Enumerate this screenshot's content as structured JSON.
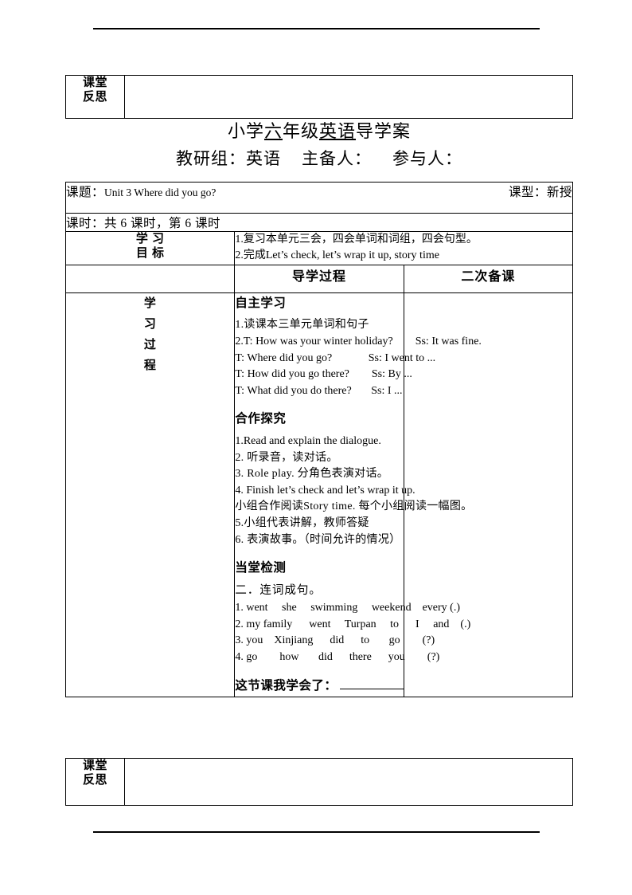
{
  "document": {
    "title_main_prefix": "小学",
    "title_underlined_1": "六",
    "title_mid": "年级",
    "title_underlined_2": "英语",
    "title_suffix": "导学案",
    "title_full": "小学六年级英语导学案",
    "subtitle_group_label": "教研组：",
    "subtitle_group_value": "英语",
    "subtitle_main_editor": "主备人：",
    "subtitle_participants": "参与人："
  },
  "reflection_top": {
    "label_line1": "课堂",
    "label_line2": "反思",
    "content": ""
  },
  "course_info": {
    "topic_label": "课题：",
    "topic_value": "Unit 3 Where did you go?",
    "type_label": "课型：",
    "type_value": "新授",
    "period_text": "课时：共 6 课时，第 6 课时",
    "period_total": "6",
    "period_current": "6"
  },
  "objectives": {
    "label_line1": "学 习",
    "label_line2": "目 标",
    "items": [
      "1.复习本单元三会，四会单词和词组，四会句型。",
      "2.完成Let’s check, let’s wrap it up, story time"
    ]
  },
  "process_header": {
    "main": "导学过程",
    "secondary": "二次备课"
  },
  "process": {
    "label_line1": "学",
    "label_line2": "习",
    "label_line3": "过",
    "label_line4": "程",
    "secondary_prep_content": "",
    "sections": [
      {
        "heading": "自主学习",
        "lines": [
          "1.读课本三单元单词和句子",
          "2.T: How was your winter holiday?        Ss: It was fine.",
          "T: Where did you go?             Ss: I went to ...",
          "T: How did you go there?        Ss: By ...",
          "T: What did you do there?       Ss: I ..."
        ]
      },
      {
        "heading": "合作探究",
        "lines": [
          "1.Read and explain the dialogue.",
          "2. 听录音，读对话。",
          "3. Role play. 分角色表演对话。",
          "4. Finish let’s check and let’s wrap it up.",
          "小组合作阅读Story time. 每个小组阅读一幅图。",
          "5.小组代表讲解，教师答疑",
          "6. 表演故事。（时间允许的情况）"
        ]
      },
      {
        "heading": "当堂检测",
        "exercise_head": "二．连词成句。",
        "lines": [
          "1. went     she     swimming     weekend    every (.)",
          "2. my family      went     Turpan     to      I     and    (.)",
          "3. you    Xinjiang      did      to       go        (?)",
          "4. go        how       did      there      you        (?)"
        ]
      }
    ],
    "learned_label": "这节课我学会了：",
    "learned_blank_value": ""
  },
  "reflection_bottom": {
    "label_line1": "课堂",
    "label_line2": "反思",
    "content": ""
  }
}
